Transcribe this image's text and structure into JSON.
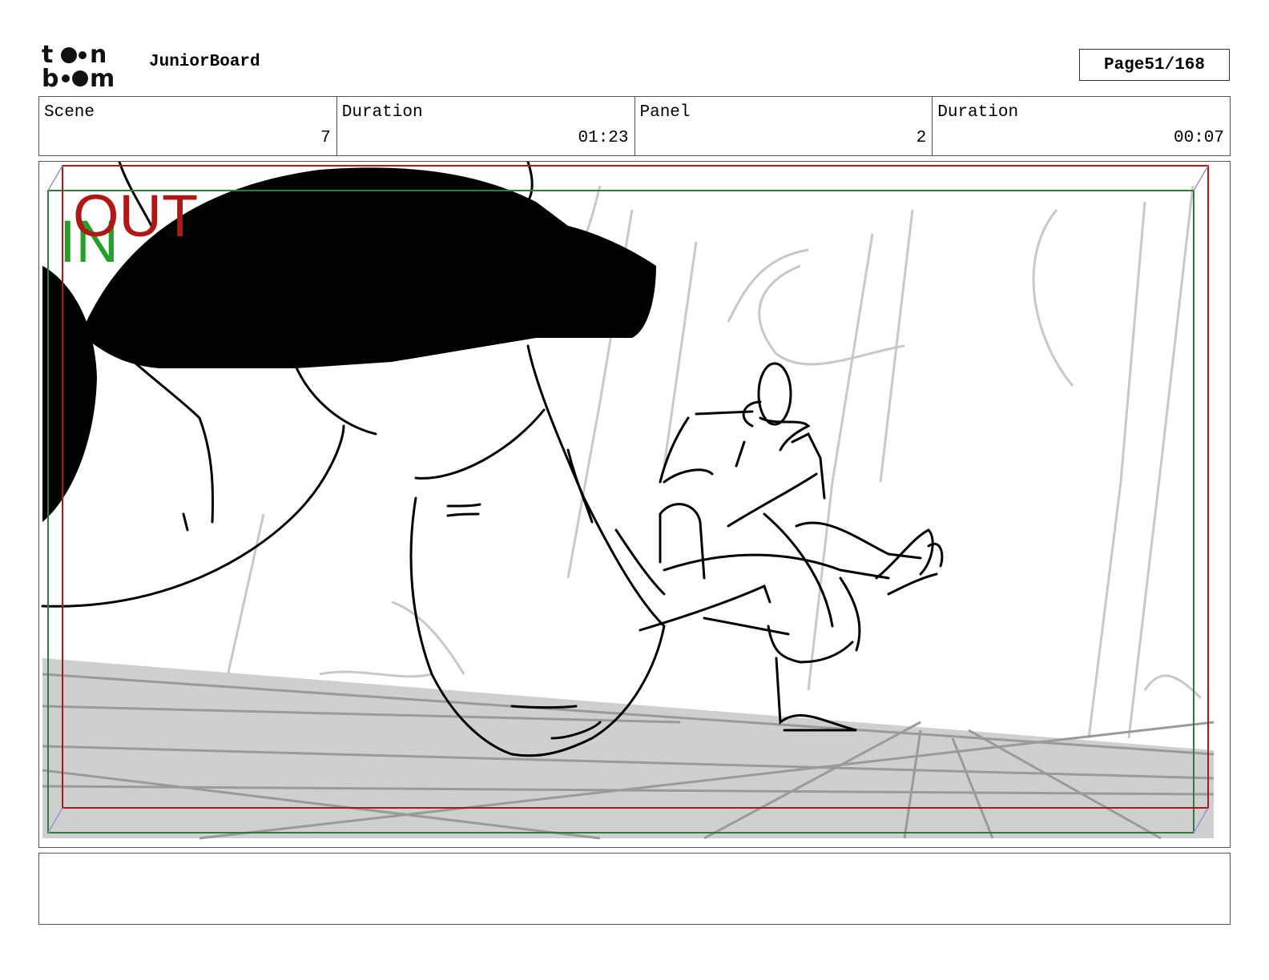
{
  "header": {
    "logo_text": "toonboom",
    "app_title": "JuniorBoard",
    "page_label": "Page",
    "page_number": "51/168"
  },
  "info": {
    "scene_label": "Scene",
    "scene_value": "7",
    "scene_duration_label": "Duration",
    "scene_duration_value": "01:23",
    "panel_label": "Panel",
    "panel_value": "2",
    "panel_duration_label": "Duration",
    "panel_duration_value": "00:07"
  },
  "panel": {
    "in_marker": "IN",
    "out_marker": "OUT",
    "in_color": "#22a02a",
    "out_color": "#b01818"
  },
  "notes": {
    "text": ""
  }
}
